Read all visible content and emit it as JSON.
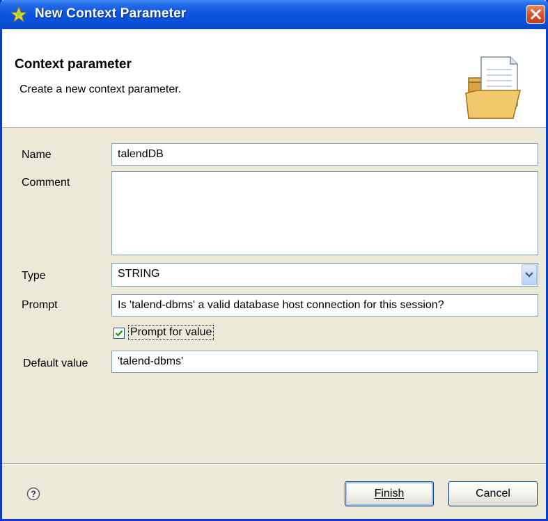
{
  "window": {
    "title": "New Context Parameter",
    "close_icon": "close-x-icon",
    "title_icon": "context-star-icon"
  },
  "banner": {
    "title": "Context parameter",
    "description": "Create a new context parameter.",
    "icon": "folder-document-icon"
  },
  "form": {
    "name_label": "Name",
    "name_value": "talendDB",
    "comment_label": "Comment",
    "comment_value": "",
    "type_label": "Type",
    "type_value": "STRING",
    "prompt_label": "Prompt",
    "prompt_value": "Is 'talend-dbms' a valid database host connection for this session?",
    "prompt_for_value_label": "Prompt for value",
    "prompt_for_value_checked": true,
    "default_label": "Default value",
    "default_value": "'talend-dbms'"
  },
  "footer": {
    "help_icon": "help-icon",
    "finish_label": "Finish",
    "cancel_label": "Cancel"
  },
  "colors": {
    "titlebar": "#0a4fd6",
    "dialog_bg": "#ece9d8",
    "field_border": "#7f9db9",
    "close_button": "#d8532d"
  }
}
